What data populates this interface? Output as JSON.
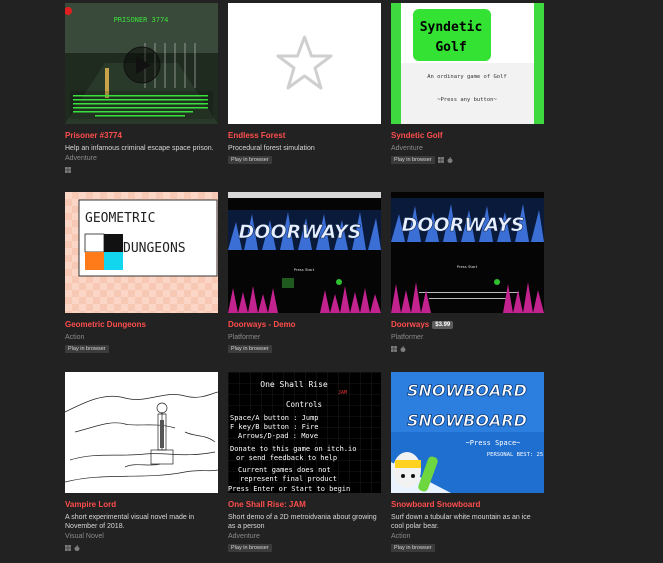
{
  "games": [
    {
      "title": "Prisoner #3774",
      "desc": "Help an infamous criminal escape space prison.",
      "genre": "Adventure",
      "badge": "",
      "price": "",
      "platforms": [
        "windows-icon"
      ],
      "thumb_text": "PRISONER 3774"
    },
    {
      "title": "Endless Forest",
      "desc": "Procedural forest simulation",
      "genre": "",
      "badge": "Play in browser",
      "price": "",
      "platforms": [],
      "thumb_text": ""
    },
    {
      "title": "Syndetic Golf",
      "desc": "",
      "genre": "Adventure",
      "badge": "Play in browser",
      "price": "",
      "platforms": [
        "windows-icon",
        "apple-icon"
      ],
      "thumb_text": "Syndetic Golf",
      "thumb_sub": "An ordinary game of Golf",
      "thumb_sub2": "~Press any button~"
    },
    {
      "title": "Geometric Dungeons",
      "desc": "",
      "genre": "Action",
      "badge": "Play in browser",
      "price": "",
      "platforms": [],
      "thumb_text": "GEOMETRIC",
      "thumb_text2": "DUNGEONS"
    },
    {
      "title": "Doorways - Demo",
      "desc": "",
      "genre": "Platformer",
      "badge": "Play in browser",
      "price": "",
      "platforms": [],
      "thumb_text": "DOORWAYS",
      "thumb_sub": "Press Start"
    },
    {
      "title": "Doorways",
      "desc": "",
      "genre": "Platformer",
      "badge": "",
      "price": "$3.99",
      "platforms": [
        "windows-icon",
        "apple-icon"
      ],
      "thumb_text": "DOORWAYS",
      "thumb_sub": "Press Start"
    },
    {
      "title": "Vampire Lord",
      "desc": "A short experimental visual novel made in November of 2018.",
      "genre": "Visual Novel",
      "badge": "",
      "price": "",
      "platforms": [
        "windows-icon",
        "apple-icon"
      ],
      "thumb_text": ""
    },
    {
      "title": "One Shall Rise: JAM",
      "desc": "Short demo of a 2D metroidvania about growing as a person",
      "genre": "Adventure",
      "badge": "Play in browser",
      "price": "",
      "platforms": [],
      "thumb_text": "One Shall Rise",
      "thumb_lines": [
        "Controls",
        "Space/A button : Jump",
        "F key/B button : Fire",
        "Arrows/D-pad : Move",
        "Donate to this game on itch.io",
        "or send feedback to help",
        "Current games does not",
        "represent final product",
        "Press Enter or Start to begin"
      ]
    },
    {
      "title": "Snowboard Snowboard",
      "desc": "Surf down a tubular white mountain as an ice cool polar bear.",
      "genre": "Action",
      "badge": "Play in browser",
      "price": "",
      "platforms": [],
      "thumb_text": "SNOWBOARD",
      "thumb_text2": "SNOWBOARD",
      "thumb_sub": "~Press Space~",
      "thumb_sub2": "PERSONAL BEST: 25"
    }
  ]
}
